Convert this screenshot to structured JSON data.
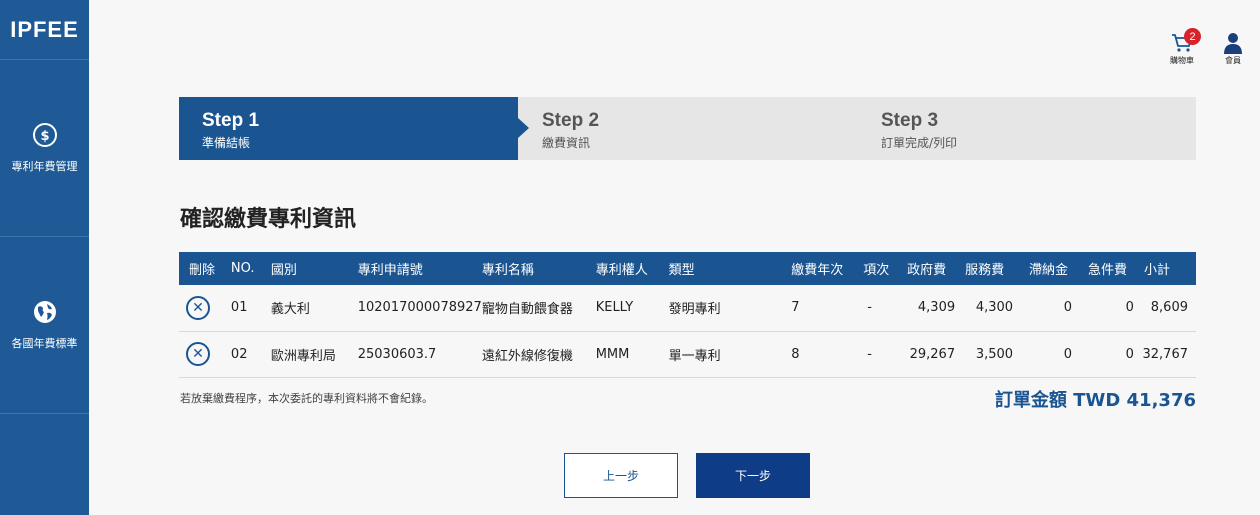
{
  "brand": {
    "logo": "IPFEE"
  },
  "sidebar": {
    "items": [
      {
        "label": "專利年費管理",
        "icon": "dollar-circle-icon"
      },
      {
        "label": "各國年費標準",
        "icon": "globe-icon"
      }
    ]
  },
  "header": {
    "cart_label": "購物車",
    "cart_count": "2",
    "member_label": "會員"
  },
  "steps": [
    {
      "title": "Step 1",
      "subtitle": "準備結帳",
      "active": true
    },
    {
      "title": "Step 2",
      "subtitle": "繳費資訊",
      "active": false
    },
    {
      "title": "Step 3",
      "subtitle": "訂單完成/列印",
      "active": false
    }
  ],
  "page_title": "確認繳費專利資訊",
  "table": {
    "headers": [
      "刪除",
      "NO.",
      "國別",
      "專利申請號",
      "專利名稱",
      "專利權人",
      "類型",
      "繳費年次",
      "項次",
      "政府費",
      "服務費",
      "滯納金",
      "急件費",
      "小計"
    ],
    "rows": [
      {
        "no": "01",
        "country": "義大利",
        "app_no": "102017000078927",
        "name": "寵物自動餵食器",
        "owner": "KELLY",
        "type": "發明專利",
        "year": "7",
        "item": "-",
        "gov_fee": "4,309",
        "service_fee": "4,300",
        "late_fee": "0",
        "urgent_fee": "0",
        "subtotal": "8,609"
      },
      {
        "no": "02",
        "country": "歐洲專利局",
        "app_no": "25030603.7",
        "name": "遠紅外線修復機",
        "owner": "MMM",
        "type": "單一專利",
        "year": "8",
        "item": "-",
        "gov_fee": "29,267",
        "service_fee": "3,500",
        "late_fee": "0",
        "urgent_fee": "0",
        "subtotal": "32,767"
      }
    ]
  },
  "note": "若放棄繳費程序，本次委託的專利資料將不會紀錄。",
  "total": "訂單金額 TWD 41,376",
  "buttons": {
    "prev": "上一步",
    "next": "下一步"
  },
  "colors": {
    "sidebar": "#1f5a96",
    "primary": "#1a5592",
    "button_dark": "#0e3c86",
    "badge": "#d8232a"
  }
}
